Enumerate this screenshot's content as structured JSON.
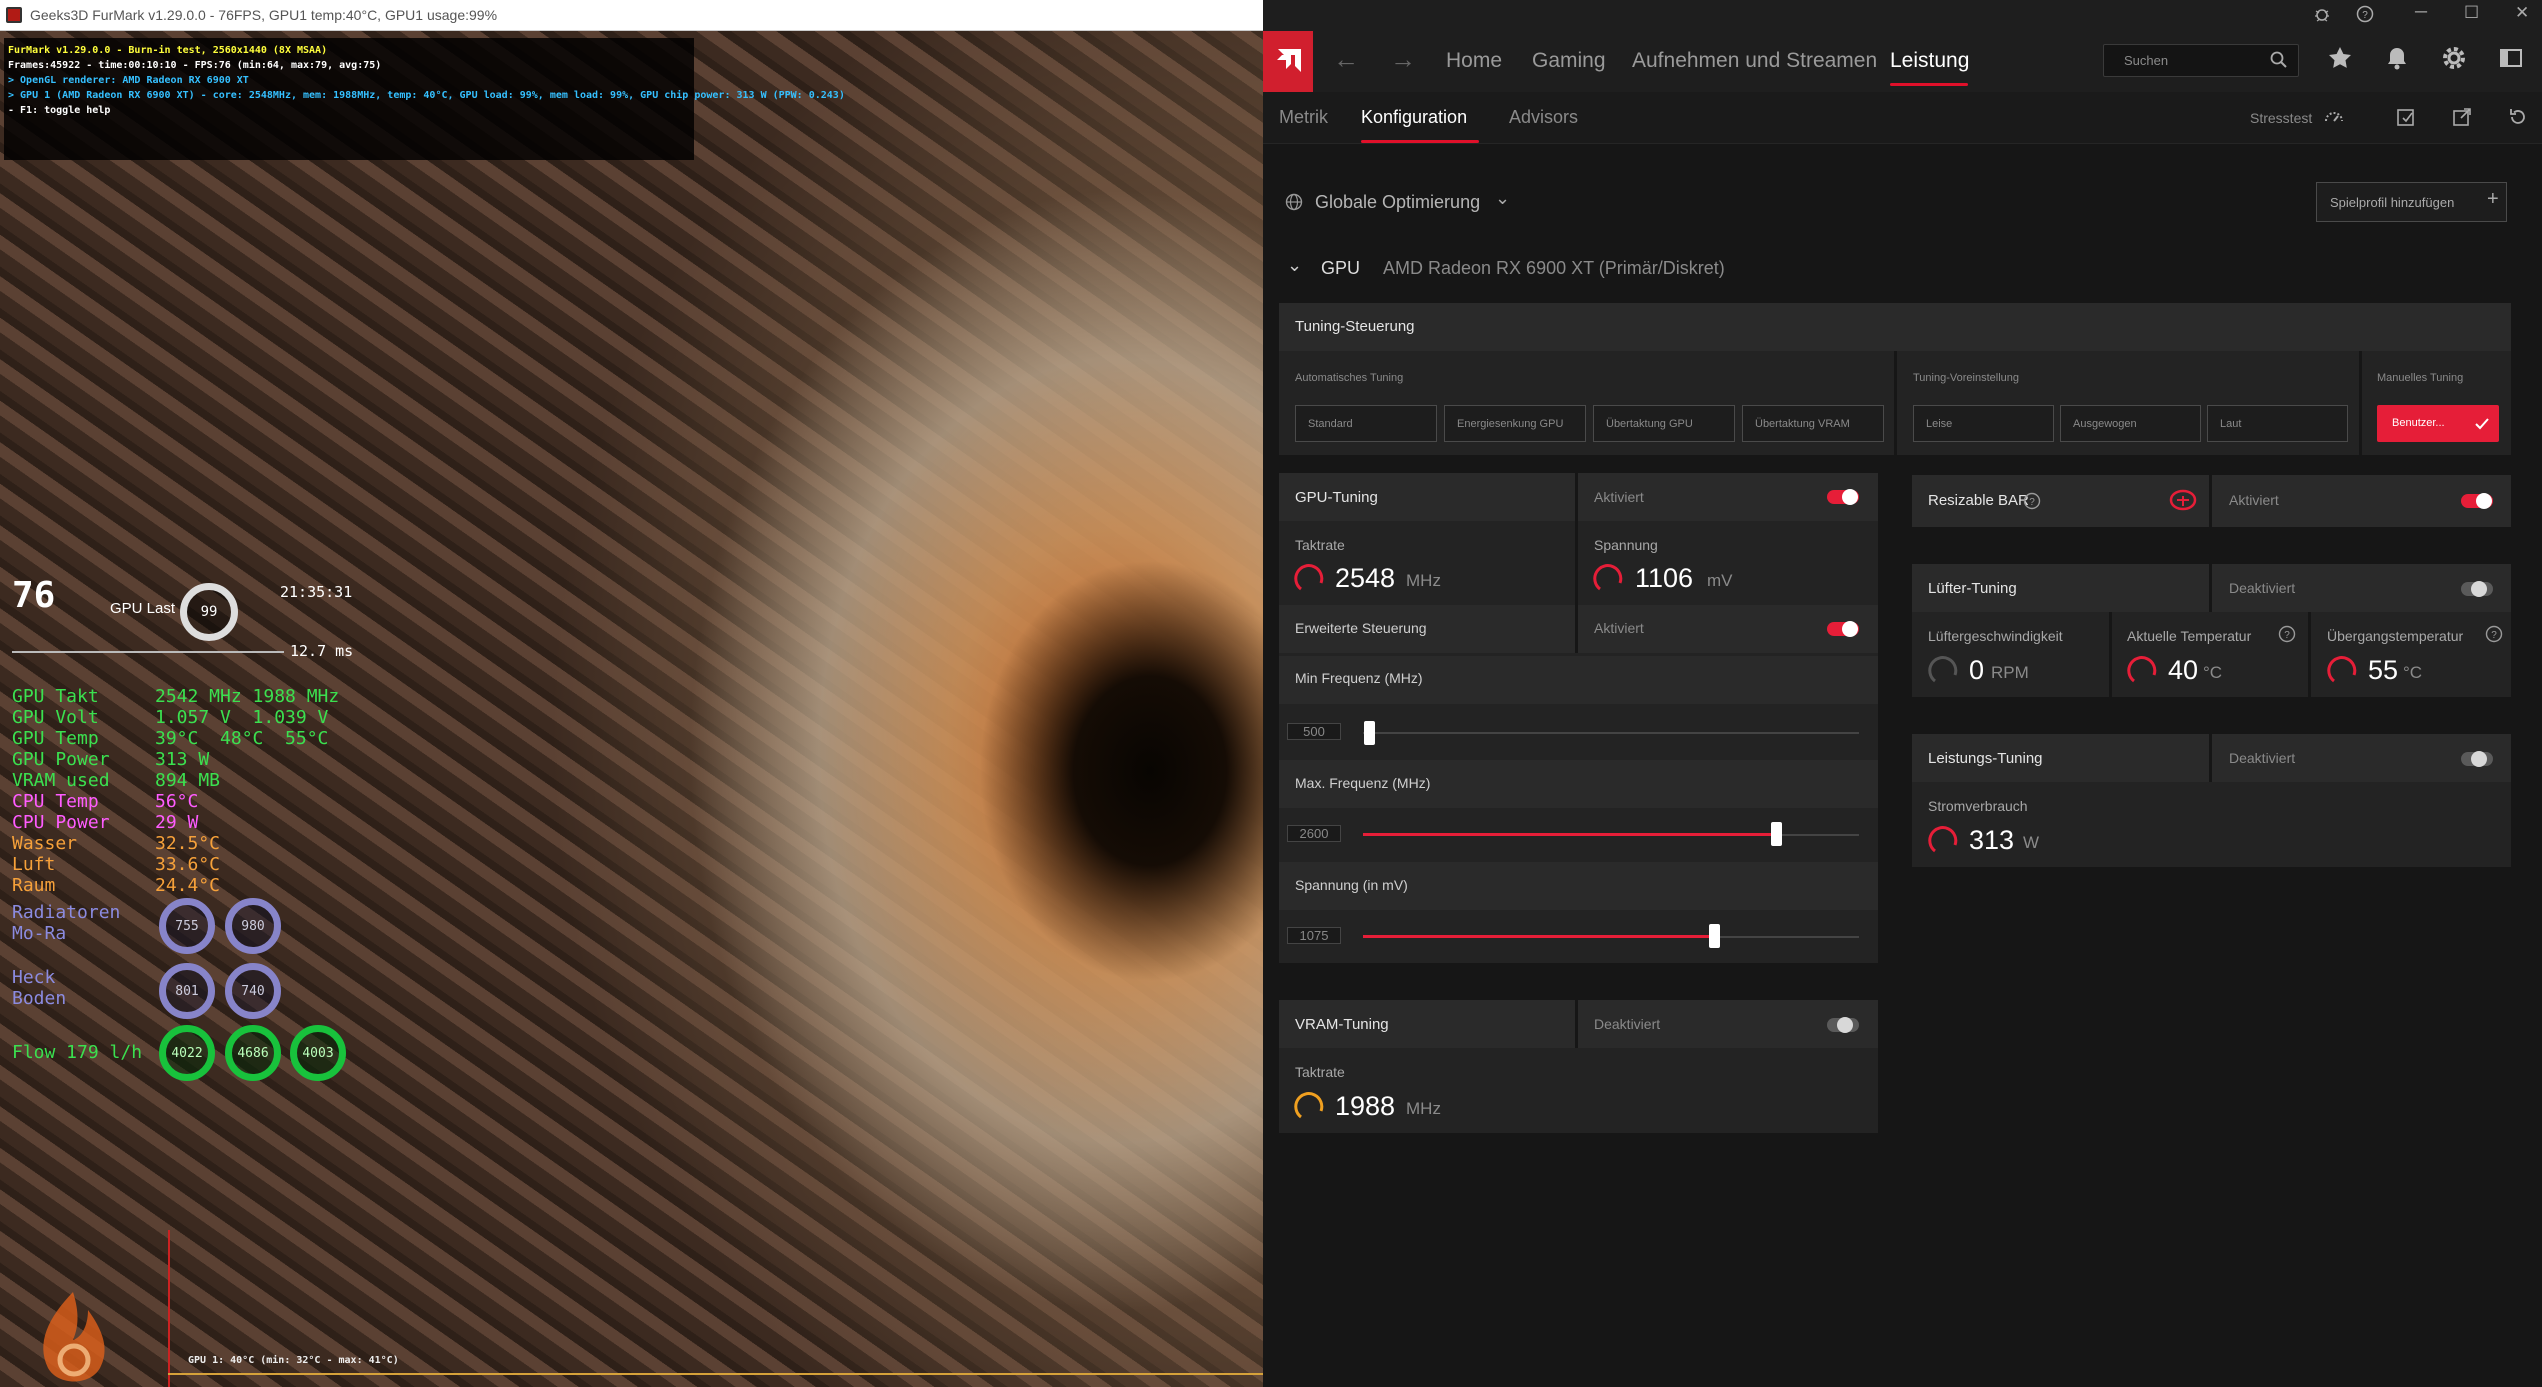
{
  "furmark": {
    "window_title": "Geeks3D FurMark v1.29.0.0 - 76FPS, GPU1 temp:40°C, GPU1 usage:99%",
    "hud_lines": [
      "FurMark v1.29.0.0 - Burn-in test, 2560x1440 (8X MSAA)",
      "Frames:45922 - time:00:10:10 - FPS:76 (min:64, max:79, avg:75)",
      "> OpenGL renderer: AMD Radeon RX 6900 XT",
      "> GPU 1 (AMD Radeon RX 6900 XT) - core: 2548MHz, mem: 1988MHz, temp: 40°C, GPU load: 99%, mem load: 99%, GPU chip power: 313 W (PPW: 0.243)",
      "- F1: toggle help"
    ],
    "hud_colors": [
      "#ffff3c",
      "#ffffff",
      "#35c0ff",
      "#35c0ff",
      "#ffffff"
    ],
    "fps": "76",
    "gpu_last_label": "GPU Last",
    "gpu_last_value": "99",
    "clock": "21:35:31",
    "frametime": "12.7 ms",
    "stats": [
      {
        "label": "GPU Takt",
        "value": "2542 MHz 1988 MHz",
        "color": "#3be04f"
      },
      {
        "label": "GPU Volt",
        "value": "1.057 V  1.039 V",
        "color": "#3be04f"
      },
      {
        "label": "GPU Temp",
        "value": "39°C  48°C  55°C",
        "color": "#3be04f"
      },
      {
        "label": "GPU Power",
        "value": "313 W",
        "color": "#3be04f"
      },
      {
        "label": "VRAM used",
        "value": "894 MB",
        "color": "#3be04f"
      },
      {
        "label": "CPU Temp",
        "value": "56°C",
        "color": "#ff5cff"
      },
      {
        "label": "CPU Power",
        "value": "29 W",
        "color": "#ff5cff"
      },
      {
        "label": "Wasser",
        "value": "32.5°C",
        "color": "#f6a13a"
      },
      {
        "label": "Luft",
        "value": "33.6°C",
        "color": "#f6a13a"
      },
      {
        "label": "Raum",
        "value": "24.4°C",
        "color": "#f6a13a"
      }
    ],
    "radiatoren_label": "Radiatoren",
    "mora_label": "Mo-Ra",
    "heck_label": "Heck",
    "boden_label": "Boden",
    "flow_label": "Flow 179 l/h",
    "fan_rings_top": [
      "755",
      "980"
    ],
    "fan_rings_bottom": [
      "801",
      "740"
    ],
    "flow_rings": [
      "4022",
      "4686",
      "4003"
    ],
    "graph_label": "GPU 1: 40°C (min: 32°C - max: 41°C)"
  },
  "amd": {
    "nav": {
      "home": "Home",
      "gaming": "Gaming",
      "record": "Aufnehmen und Streamen",
      "performance": "Leistung"
    },
    "search_placeholder": "Suchen",
    "subnav": {
      "metrics": "Metrik",
      "config": "Konfiguration",
      "advisors": "Advisors",
      "stresstest": "Stresstest"
    },
    "global_opt": "Globale Optimierung",
    "add_profile": "Spielprofil hinzufügen",
    "gpu_label": "GPU",
    "gpu_name": "AMD Radeon RX 6900 XT (Primär/Diskret)",
    "tuning_control": "Tuning-Steuerung",
    "auto_tuning": "Automatisches Tuning",
    "auto_presets": [
      "Standard",
      "Energiesenkung GPU",
      "Übertaktung GPU",
      "Übertaktung VRAM"
    ],
    "tuning_preset": "Tuning-Voreinstellung",
    "tuning_presets": [
      "Leise",
      "Ausgewogen",
      "Laut"
    ],
    "manual_tuning": "Manuelles Tuning",
    "custom_btn": "Benutzer...",
    "gpu_tuning": "GPU-Tuning",
    "activated": "Aktiviert",
    "deactivated": "Deaktiviert",
    "clock_label": "Taktrate",
    "clock_value": "2548",
    "mhz": "MHz",
    "voltage_label": "Spannung",
    "voltage_value": "1106",
    "mv": "mV",
    "advanced": "Erweiterte Steuerung",
    "min_freq": "Min Frequenz (MHz)",
    "min_freq_value": "500",
    "max_freq": "Max. Frequenz (MHz)",
    "max_freq_value": "2600",
    "voltage_mv": "Spannung (in mV)",
    "voltage_mv_value": "1075",
    "vram_tuning": "VRAM-Tuning",
    "vram_clock_value": "1988",
    "resizable_bar": "Resizable BAR",
    "fan_tuning": "Lüfter-Tuning",
    "fan_speed": "Lüftergeschwindigkeit",
    "fan_speed_value": "0",
    "rpm": "RPM",
    "current_temp": "Aktuelle Temperatur",
    "current_temp_value": "40",
    "junction_temp": "Übergangstemperatur",
    "junction_temp_value": "55",
    "celsius": "°C",
    "power_tuning": "Leistungs-Tuning",
    "power_use": "Stromverbrauch",
    "power_value": "313",
    "watt": "W",
    "accent": "#e61e38",
    "vram_gauge_color": "#f0a020"
  }
}
